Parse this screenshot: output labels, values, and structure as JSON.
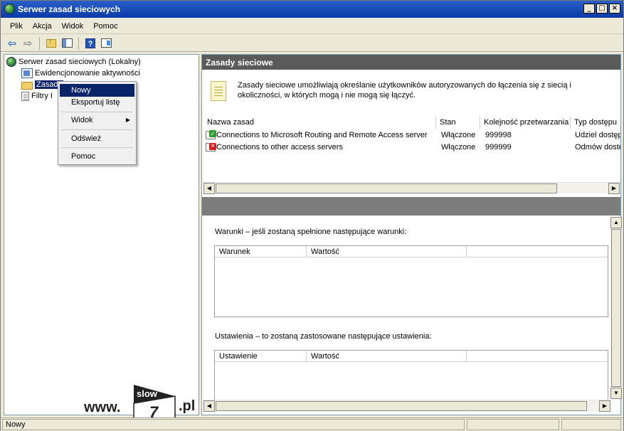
{
  "window": {
    "title": "Serwer zasad sieciowych"
  },
  "menu": [
    "Plik",
    "Akcja",
    "Widok",
    "Pomoc"
  ],
  "tree": {
    "root": "Serwer zasad sieciowych (Lokalny)",
    "items": [
      "Ewidencjonowanie aktywności",
      "Zasady",
      "Filtry I"
    ]
  },
  "context_menu": {
    "items": [
      "Nowy",
      "Eksportuj listę",
      "Widok",
      "Odśwież",
      "Pomoc"
    ]
  },
  "watermark": {
    "prefix": "www.",
    "logo_top": "slow",
    "logo_bottom": "7",
    "suffix": ".pl"
  },
  "right_pane": {
    "header": "Zasady sieciowe",
    "description": "Zasady sieciowe umożliwiają określanie użytkowników autoryzowanych do łączenia się z siecią i okoliczności, w których mogą i nie mogą się łączyć.",
    "columns": [
      "Nazwa zasad",
      "Stan",
      "Kolejność przetwarzania",
      "Typ dostępu"
    ],
    "policies": [
      {
        "name": "Connections to Microsoft Routing and Remote Access server",
        "state": "Włączone",
        "order": "999998",
        "access": "Udziel dostęp",
        "icon": "allow-icon"
      },
      {
        "name": "Connections to other access servers",
        "state": "Włączone",
        "order": "999999",
        "access": "Odmów dostę",
        "icon": "deny-icon"
      }
    ],
    "conditions_label": "Warunki – jeśli zostaną spełnione następujące warunki:",
    "conditions_columns": [
      "Warunek",
      "Wartość"
    ],
    "settings_label": "Ustawienia – to zostaną zastosowane następujące ustawienia:",
    "settings_columns": [
      "Ustawienie",
      "Wartość"
    ]
  },
  "status_bar": {
    "text": "Nowy"
  }
}
